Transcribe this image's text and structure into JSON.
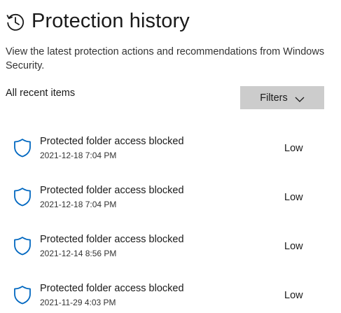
{
  "header": {
    "icon": "history-icon",
    "title": "Protection history"
  },
  "description": "View the latest protection actions and recommendations from Windows Security.",
  "section_label": "All recent items",
  "filters": {
    "label": "Filters",
    "icon": "chevron-down-icon"
  },
  "colors": {
    "accent": "#0067c0",
    "filters_bg": "#cccccc"
  },
  "items": [
    {
      "icon": "shield-icon",
      "title": "Protected folder access blocked",
      "date": "2021-12-18 7:04 PM",
      "severity": "Low"
    },
    {
      "icon": "shield-icon",
      "title": "Protected folder access blocked",
      "date": "2021-12-18 7:04 PM",
      "severity": "Low"
    },
    {
      "icon": "shield-icon",
      "title": "Protected folder access blocked",
      "date": "2021-12-14 8:56 PM",
      "severity": "Low"
    },
    {
      "icon": "shield-icon",
      "title": "Protected folder access blocked",
      "date": "2021-11-29 4:03 PM",
      "severity": "Low"
    }
  ]
}
